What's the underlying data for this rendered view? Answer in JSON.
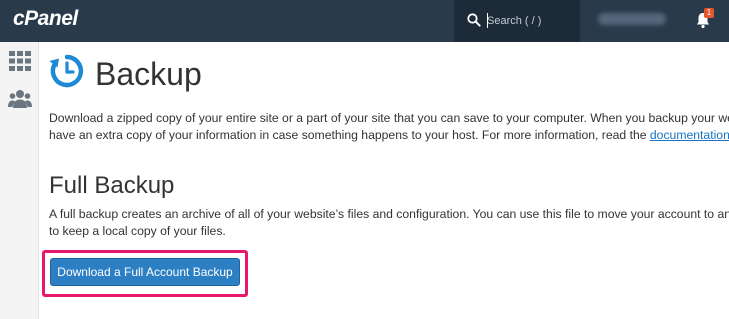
{
  "header": {
    "logo": "cPanel",
    "search": {
      "placeholder": "Search ( / )",
      "value": ""
    },
    "notification_count": "1",
    "bar_color": "#293a4a"
  },
  "sidebar": {
    "items": [
      {
        "icon": "grid-icon"
      },
      {
        "icon": "users-icon"
      }
    ]
  },
  "page": {
    "title": "Backup",
    "intro_line1": "Download a zipped copy of your entire site or a part of your site that you can save to your computer. When you backup your website",
    "intro_line2_prefix": "have an extra copy of your information in case something happens to your host. For more information, read the ",
    "documentation_link": "documentation",
    "intro_line2_suffix": "."
  },
  "full_backup": {
    "title": "Full Backup",
    "desc_line1": "A full backup creates an archive of all of your website’s files and configuration. You can use this file to move your account to another",
    "desc_line2": "to keep a local copy of your files.",
    "button_label": "Download a Full Account Backup",
    "button_color": "#2d7fc4",
    "highlight_color": "#e8186d"
  }
}
